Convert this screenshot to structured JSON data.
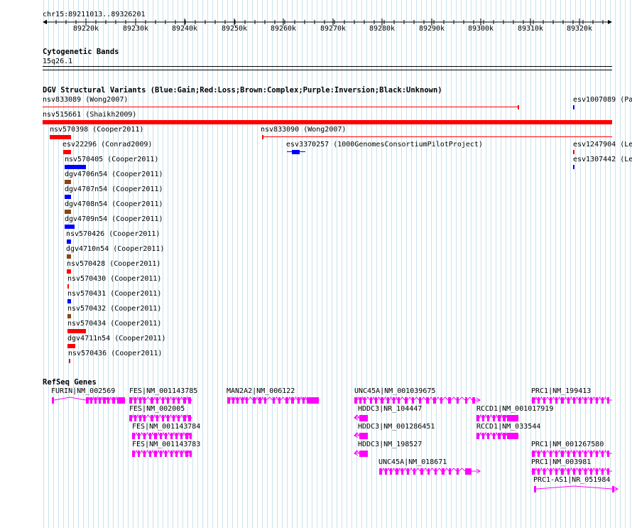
{
  "colors": {
    "gain": "#0000ff",
    "loss": "#ff0000",
    "complex": "#8b4513",
    "gene": "#ff00ff",
    "grid": "#c9e3ec"
  },
  "ruler": {
    "range_label": "chr15:89211013..89326201",
    "ticks": [
      "89220k",
      "89230k",
      "89240k",
      "89250k",
      "89260k",
      "89270k",
      "89280k",
      "89290k",
      "89300k",
      "89310k",
      "89320k"
    ]
  },
  "cytoband": {
    "title": "Cytogenetic Bands",
    "band": "15q26.1"
  },
  "dgv": {
    "title": "DGV Structural Variants (Blue:Gain;Red:Loss;Brown:Complex;Purple:Inversion;Black:Unknown)",
    "features": [
      {
        "label": "nsv833089 (Wong2007)",
        "kind": "loss",
        "style": "line"
      },
      {
        "label": "esv1007089 (Pa",
        "kind": "gain",
        "style": "tick"
      },
      {
        "label": "nsv515661 (Shaikh2009)",
        "kind": "loss",
        "style": "bar"
      },
      {
        "label": "nsv570398 (Cooper2011)",
        "kind": "loss",
        "style": "bar"
      },
      {
        "label": "nsv833090 (Wong2007)",
        "kind": "loss",
        "style": "line"
      },
      {
        "label": "esv22296 (Conrad2009)",
        "kind": "loss",
        "style": "bar"
      },
      {
        "label": "esv3370257 (1000GenomesConsortiumPilotProject)",
        "kind": "gain",
        "style": "exon"
      },
      {
        "label": "esv1247904 (Le",
        "kind": "loss",
        "style": "tick"
      },
      {
        "label": "nsv570405 (Cooper2011)",
        "kind": "gain",
        "style": "bar"
      },
      {
        "label": "esv1307442 (Le",
        "kind": "gain",
        "style": "tick"
      },
      {
        "label": "dgv4706n54 (Cooper2011)",
        "kind": "complex",
        "style": "bar"
      },
      {
        "label": "dgv4707n54 (Cooper2011)",
        "kind": "gain",
        "style": "bar"
      },
      {
        "label": "dgv4708n54 (Cooper2011)",
        "kind": "complex",
        "style": "bar"
      },
      {
        "label": "dgv4709n54 (Cooper2011)",
        "kind": "gain",
        "style": "bar"
      },
      {
        "label": "nsv570426 (Cooper2011)",
        "kind": "gain",
        "style": "bar"
      },
      {
        "label": "dgv4710n54 (Cooper2011)",
        "kind": "complex",
        "style": "bar"
      },
      {
        "label": "nsv570428 (Cooper2011)",
        "kind": "loss",
        "style": "bar"
      },
      {
        "label": "nsv570430 (Cooper2011)",
        "kind": "loss",
        "style": "bar"
      },
      {
        "label": "nsv570431 (Cooper2011)",
        "kind": "gain",
        "style": "bar"
      },
      {
        "label": "nsv570432 (Cooper2011)",
        "kind": "complex",
        "style": "bar"
      },
      {
        "label": "nsv570434 (Cooper2011)",
        "kind": "loss",
        "style": "bar"
      },
      {
        "label": "dgv4711n54 (Cooper2011)",
        "kind": "loss",
        "style": "bar"
      },
      {
        "label": "nsv570436 (Cooper2011)",
        "kind": "loss",
        "style": "bar"
      }
    ]
  },
  "refseq": {
    "title": "RefSeq Genes",
    "genes": [
      {
        "label": "FURIN|NM_002569",
        "strand": "+"
      },
      {
        "label": "FES|NM_001143785",
        "strand": "+"
      },
      {
        "label": "MAN2A2|NM_006122",
        "strand": "+"
      },
      {
        "label": "UNC45A|NM_001039675",
        "strand": "+"
      },
      {
        "label": "PRC1|NM_199413",
        "strand": "-"
      },
      {
        "label": "FES|NM_002005",
        "strand": "+"
      },
      {
        "label": "HDDC3|NR_104447",
        "strand": "-"
      },
      {
        "label": "RCCD1|NM_001017919",
        "strand": "+"
      },
      {
        "label": "FES|NM_001143784",
        "strand": "+"
      },
      {
        "label": "HDDC3|NM_001286451",
        "strand": "-"
      },
      {
        "label": "RCCD1|NM_033544",
        "strand": "+"
      },
      {
        "label": "FES|NM_001143783",
        "strand": "+"
      },
      {
        "label": "HDDC3|NM_198527",
        "strand": "-"
      },
      {
        "label": "PRC1|NM_001267580",
        "strand": "-"
      },
      {
        "label": "UNC45A|NM_018671",
        "strand": "+"
      },
      {
        "label": "PRC1|NM_003981",
        "strand": "-"
      },
      {
        "label": "PRC1-AS1|NR_051984",
        "strand": "+"
      }
    ]
  }
}
